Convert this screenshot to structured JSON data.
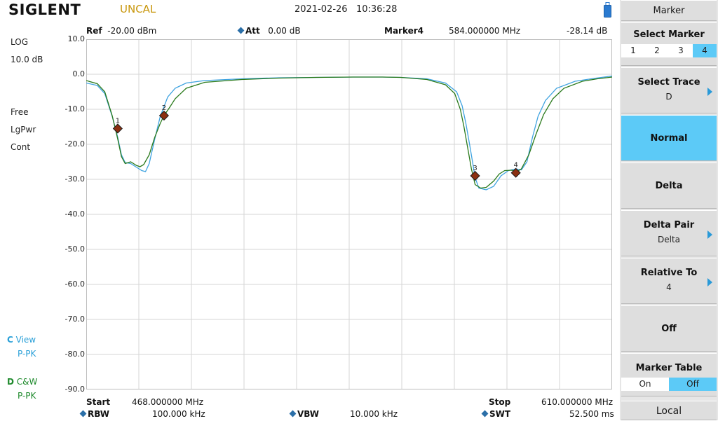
{
  "header": {
    "logo": "SIGLENT",
    "uncal": "UNCAL",
    "date": "2021-02-26",
    "time": "10:36:28"
  },
  "info": {
    "ref_label": "Ref",
    "ref_value": "-20.00 dBm",
    "att_label": "Att",
    "att_value": "0.00 dB",
    "marker_label": "Marker4",
    "marker_freq": "584.000000 MHz",
    "marker_level": "-28.14 dB"
  },
  "left": {
    "scale": "LOG",
    "div": "10.0 dB",
    "trig": "Free",
    "det": "LgPwr",
    "sweep": "Cont",
    "trace_c_letter": "C",
    "trace_c_mode": "View",
    "trace_c_det": "P-PK",
    "trace_d_letter": "D",
    "trace_d_mode": "C&W",
    "trace_d_det": "P-PK"
  },
  "bottom": {
    "start_label": "Start",
    "start_value": "468.000000 MHz",
    "stop_label": "Stop",
    "stop_value": "610.000000 MHz",
    "rbw_label": "RBW",
    "rbw_value": "100.000 kHz",
    "vbw_label": "VBW",
    "vbw_value": "10.000 kHz",
    "swt_label": "SWT",
    "swt_value": "52.500 ms"
  },
  "panel": {
    "title": "Marker",
    "select_marker": "Select Marker",
    "marker_options": [
      "1",
      "2",
      "3",
      "4"
    ],
    "selected_marker": "4",
    "select_trace": "Select Trace",
    "select_trace_value": "D",
    "normal": "Normal",
    "delta": "Delta",
    "delta_pair": "Delta Pair",
    "delta_pair_value": "Delta",
    "relative_to": "Relative To",
    "relative_to_value": "4",
    "off": "Off",
    "marker_table": "Marker Table",
    "marker_table_options": [
      "On",
      "Off"
    ],
    "marker_table_selected": "Off",
    "local": "Local"
  },
  "colors": {
    "accent": "#5ccaf7",
    "trace_c": "#3fa3e0",
    "trace_d": "#2a7a1c",
    "marker": "#8b2f10",
    "grid": "#d6d6d6",
    "uncal": "#c8960a"
  },
  "chart_data": {
    "type": "line",
    "x_range": [
      468.0,
      610.0
    ],
    "x_unit": "MHz",
    "ylim": [
      -90.0,
      10.0
    ],
    "y_ticks": [
      "10.0",
      "0.0",
      "-10.0",
      "-20.0",
      "-30.0",
      "-40.0",
      "-50.0",
      "-60.0",
      "-70.0",
      "-80.0",
      "-90.0"
    ],
    "grid": true,
    "series": [
      {
        "name": "C",
        "points": [
          [
            468.0,
            -2.5
          ],
          [
            471.0,
            -3.2
          ],
          [
            473.0,
            -5.5
          ],
          [
            475.0,
            -12.0
          ],
          [
            476.5,
            -18.0
          ],
          [
            477.5,
            -23.0
          ],
          [
            478.5,
            -25.2
          ],
          [
            480.0,
            -25.5
          ],
          [
            481.5,
            -26.5
          ],
          [
            483.0,
            -27.5
          ],
          [
            484.0,
            -27.8
          ],
          [
            485.0,
            -25.5
          ],
          [
            486.5,
            -18.5
          ],
          [
            488.0,
            -12.0
          ],
          [
            490.0,
            -6.5
          ],
          [
            492.0,
            -4.0
          ],
          [
            495.0,
            -2.5
          ],
          [
            500.0,
            -1.8
          ],
          [
            510.0,
            -1.3
          ],
          [
            520.0,
            -1.0
          ],
          [
            530.0,
            -0.9
          ],
          [
            540.0,
            -0.8
          ],
          [
            548.0,
            -0.8
          ],
          [
            553.0,
            -0.9
          ],
          [
            560.0,
            -1.3
          ],
          [
            565.0,
            -2.5
          ],
          [
            568.0,
            -5.0
          ],
          [
            569.5,
            -9.0
          ],
          [
            570.5,
            -14.0
          ],
          [
            571.5,
            -20.0
          ],
          [
            572.3,
            -25.0
          ],
          [
            573.0,
            -29.5
          ],
          [
            574.0,
            -32.5
          ],
          [
            576.0,
            -33.0
          ],
          [
            578.0,
            -32.0
          ],
          [
            580.0,
            -29.0
          ],
          [
            582.0,
            -27.5
          ],
          [
            584.0,
            -27.0
          ],
          [
            585.5,
            -27.3
          ],
          [
            587.0,
            -25.0
          ],
          [
            588.5,
            -18.0
          ],
          [
            590.0,
            -12.0
          ],
          [
            592.0,
            -7.5
          ],
          [
            595.0,
            -4.0
          ],
          [
            600.0,
            -2.0
          ],
          [
            605.0,
            -1.2
          ],
          [
            610.0,
            -0.5
          ]
        ]
      },
      {
        "name": "D",
        "points": [
          [
            468.0,
            -1.8
          ],
          [
            471.0,
            -2.7
          ],
          [
            473.0,
            -5.0
          ],
          [
            475.0,
            -11.8
          ],
          [
            476.5,
            -18.5
          ],
          [
            477.5,
            -23.5
          ],
          [
            478.5,
            -25.5
          ],
          [
            480.0,
            -25.0
          ],
          [
            481.5,
            -26.0
          ],
          [
            482.5,
            -26.4
          ],
          [
            483.5,
            -25.8
          ],
          [
            485.0,
            -23.0
          ],
          [
            486.5,
            -18.0
          ],
          [
            488.0,
            -14.0
          ],
          [
            489.0,
            -11.8
          ],
          [
            490.5,
            -9.5
          ],
          [
            492.0,
            -7.0
          ],
          [
            495.0,
            -4.0
          ],
          [
            500.0,
            -2.3
          ],
          [
            510.0,
            -1.5
          ],
          [
            520.0,
            -1.1
          ],
          [
            530.0,
            -0.9
          ],
          [
            540.0,
            -0.8
          ],
          [
            548.0,
            -0.8
          ],
          [
            553.0,
            -0.9
          ],
          [
            560.0,
            -1.5
          ],
          [
            565.0,
            -3.0
          ],
          [
            567.5,
            -5.5
          ],
          [
            569.0,
            -10.0
          ],
          [
            570.0,
            -15.0
          ],
          [
            571.0,
            -21.0
          ],
          [
            572.0,
            -27.0
          ],
          [
            573.0,
            -31.5
          ],
          [
            574.5,
            -32.5
          ],
          [
            576.0,
            -32.3
          ],
          [
            578.0,
            -30.5
          ],
          [
            579.5,
            -28.5
          ],
          [
            581.0,
            -27.5
          ],
          [
            583.0,
            -27.4
          ],
          [
            584.0,
            -28.0
          ],
          [
            585.5,
            -27.0
          ],
          [
            587.5,
            -23.0
          ],
          [
            589.5,
            -17.0
          ],
          [
            591.5,
            -11.5
          ],
          [
            594.0,
            -7.0
          ],
          [
            597.0,
            -4.0
          ],
          [
            602.0,
            -2.0
          ],
          [
            606.0,
            -1.3
          ],
          [
            610.0,
            -0.8
          ]
        ]
      }
    ],
    "markers": [
      {
        "label": "1",
        "x": 476.5,
        "y": -15.5
      },
      {
        "label": "2",
        "x": 489.0,
        "y": -11.8
      },
      {
        "label": "3",
        "x": 573.0,
        "y": -29.0
      },
      {
        "label": "4",
        "x": 584.0,
        "y": -28.14
      }
    ]
  }
}
